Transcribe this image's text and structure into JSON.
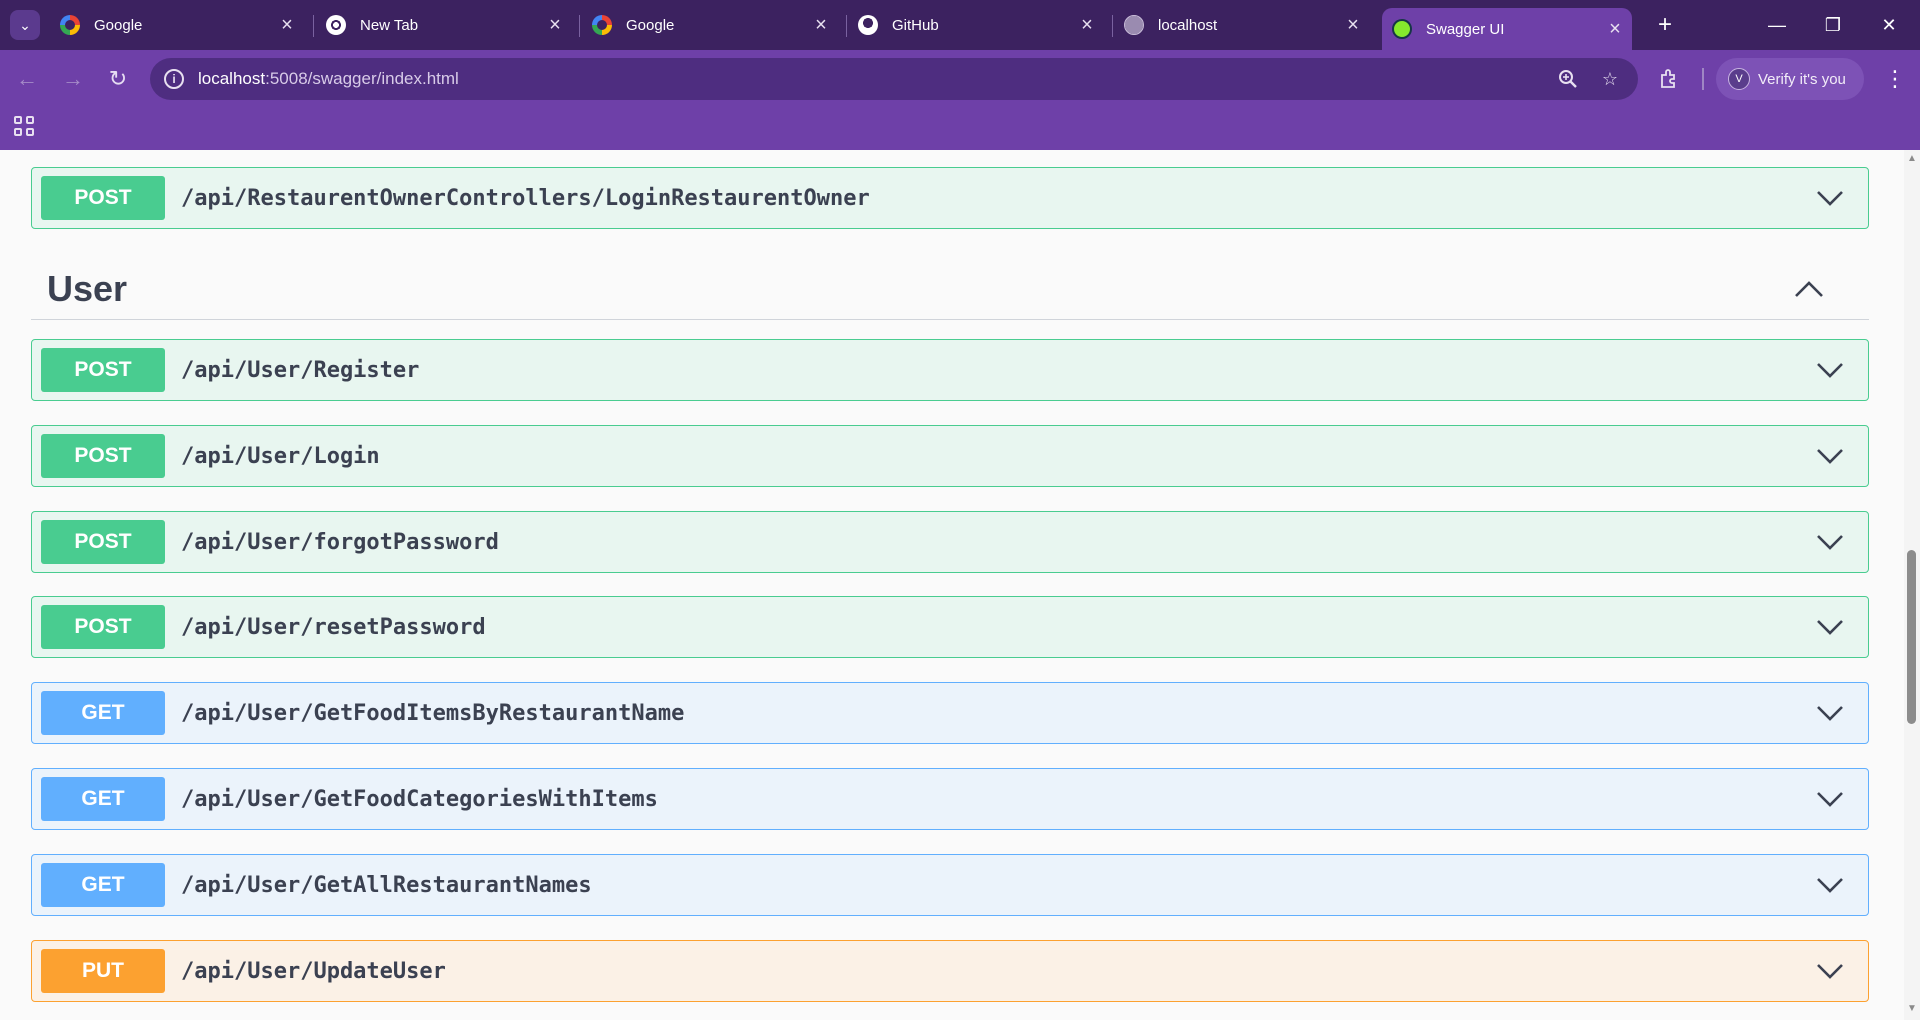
{
  "browser": {
    "tabs": [
      {
        "label": "Google",
        "icon": "google-icon",
        "active": false
      },
      {
        "label": "New Tab",
        "icon": "chrome-icon",
        "active": false
      },
      {
        "label": "Google",
        "icon": "google-icon",
        "active": false
      },
      {
        "label": "GitHub",
        "icon": "github-icon",
        "active": false
      },
      {
        "label": "localhost",
        "icon": "globe-icon",
        "active": false
      },
      {
        "label": "Swagger UI",
        "icon": "swagger-icon",
        "active": true
      }
    ],
    "url_host": "localhost",
    "url_path": ":5008/swagger/index.html",
    "verify_label": "Verify it's you",
    "verify_avatar": "V",
    "theme_color": "#6e40a8"
  },
  "swagger": {
    "top_operation": {
      "method": "POST",
      "path": "/api/RestaurentOwnerControllers/LoginRestaurentOwner"
    },
    "tag": {
      "name": "User",
      "expanded": true
    },
    "operations": [
      {
        "method": "POST",
        "path": "/api/User/Register"
      },
      {
        "method": "POST",
        "path": "/api/User/Login"
      },
      {
        "method": "POST",
        "path": "/api/User/forgotPassword"
      },
      {
        "method": "POST",
        "path": "/api/User/resetPassword"
      },
      {
        "method": "GET",
        "path": "/api/User/GetFoodItemsByRestaurantName"
      },
      {
        "method": "GET",
        "path": "/api/User/GetFoodCategoriesWithItems"
      },
      {
        "method": "GET",
        "path": "/api/User/GetAllRestaurantNames"
      },
      {
        "method": "PUT",
        "path": "/api/User/UpdateUser"
      }
    ],
    "method_colors": {
      "POST": "#49cc90",
      "GET": "#61affe",
      "PUT": "#fca130"
    }
  }
}
